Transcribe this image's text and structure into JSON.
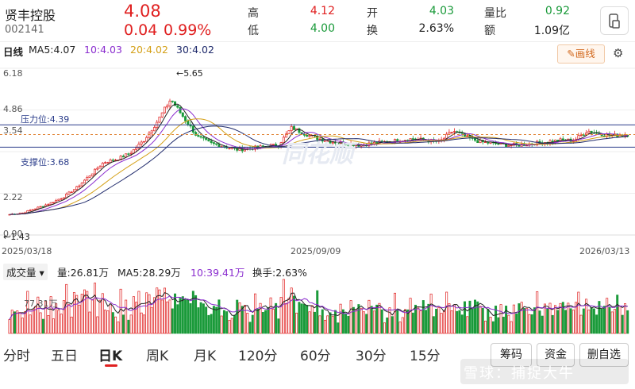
{
  "stock": {
    "name": "贤丰控股",
    "code": "002141",
    "price": "4.08",
    "change": "0.04",
    "change_pct": "0.99%"
  },
  "quote": {
    "high_label": "高",
    "high": "4.12",
    "low_label": "低",
    "low": "4.00",
    "open_label": "开",
    "open": "4.03",
    "turnover_label": "换",
    "turnover": "2.63%",
    "vol_ratio_label": "量比",
    "vol_ratio": "0.92",
    "amount_label": "额",
    "amount": "1.09亿"
  },
  "ma_bar": {
    "period": "日线",
    "ma5": "MA5:4.07",
    "ma10": "10:4.03",
    "ma20": "20:4.02",
    "ma30": "30:4.02",
    "draw_label": "画线"
  },
  "kline": {
    "y_ticks": [
      "6.18",
      "4.86",
      "3.54",
      "2.22",
      "0.90"
    ],
    "pressure_label": "压力位:4.39",
    "support_label": "支撑位:3.68",
    "max_label": "←5.65",
    "min_label": "←1.43",
    "x_ticks": [
      "2025/03/18",
      "2025/09/09",
      "2026/03/13"
    ],
    "watermark": "同花顺"
  },
  "volume": {
    "selector_label": "成交量",
    "vol": "量:26.81万",
    "ma5": "MA5:28.29万",
    "ma10": "10:39.41万",
    "turnover": "换手:2.63%",
    "y_tick": "77.31万"
  },
  "tabs": [
    "分时",
    "五日",
    "日K",
    "周K",
    "月K",
    "120分",
    "60分",
    "30分",
    "15分"
  ],
  "active_tab": "日K",
  "side_buttons": {
    "chips": "筹码",
    "funds": "资金",
    "remove": "删自选"
  },
  "watermark": "雪球：捕捉大牛",
  "colors": {
    "up": "#e02020",
    "down": "#1a9a3a",
    "ma5": "#222222",
    "ma10": "#8b2ecf",
    "ma20": "#d4a017",
    "ma30": "#1f2a6b",
    "accent": "#d2691e"
  },
  "chart_data": {
    "type": "candlestick",
    "y_range": [
      0.9,
      6.18
    ],
    "ref_lines": {
      "pressure": 4.39,
      "support": 3.68
    },
    "annotations": {
      "max": 5.65,
      "min": 1.43
    },
    "close_approx": [
      1.55,
      1.6,
      1.75,
      1.9,
      2.1,
      2.4,
      2.8,
      3.2,
      3.3,
      3.5,
      3.9,
      4.5,
      5.2,
      4.6,
      4.0,
      3.8,
      3.7,
      3.6,
      3.65,
      3.7,
      3.75,
      4.3,
      4.1,
      3.95,
      3.85,
      3.8,
      3.75,
      3.8,
      3.85,
      3.9,
      3.95,
      3.9,
      3.85,
      4.2,
      4.0,
      3.85,
      3.8,
      3.75,
      3.75,
      3.8,
      3.85,
      3.9,
      3.9,
      4.2,
      4.1,
      4.05,
      4.08
    ]
  }
}
